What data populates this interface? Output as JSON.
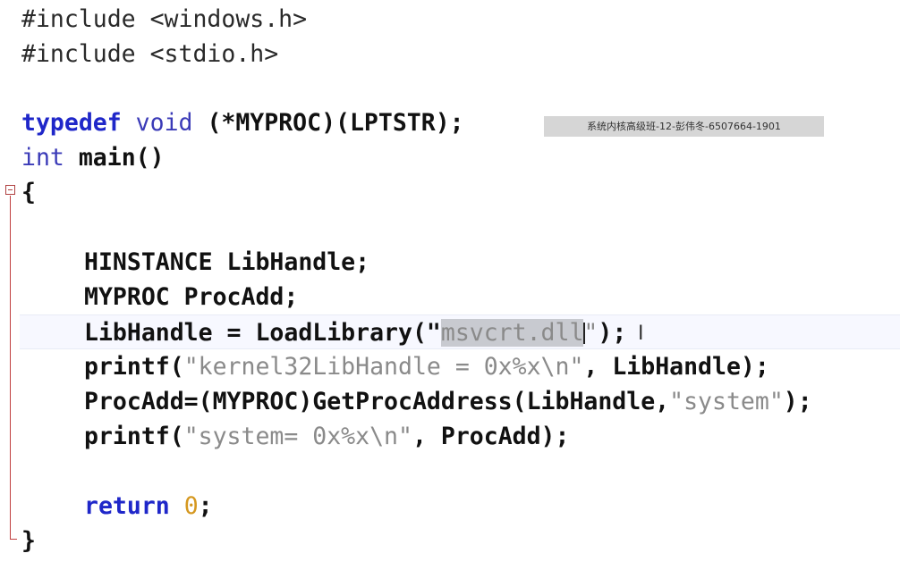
{
  "editor": {
    "lines": {
      "include1_kw": "#include",
      "include1_file": " <windows.h>",
      "include2_kw": "#include",
      "include2_file": " <stdio.h>",
      "typedef_kw": "typedef",
      "typedef_void": "void",
      "typedef_rest": " (*MYPROC)(LPTSTR);",
      "main_kw": "int",
      "main_rest": " main()",
      "open_brace": "{",
      "decl1": "HINSTANCE LibHandle;",
      "decl2": "MYPROC ProcAdd;",
      "load_pre": "LibHandle = LoadLibrary(\"",
      "load_sel": "msvcrt.dll",
      "load_post_str": "\"",
      "load_end": ");",
      "printf1_fn": "printf(",
      "printf1_str": "\"kernel32LibHandle = 0x%x\\n\"",
      "printf1_end": ", LibHandle);",
      "procadd_pre": "ProcAdd=(MYPROC)GetProcAddress(LibHandle,",
      "procadd_str": "\"system\"",
      "procadd_end": ");",
      "printf2_fn": "printf(",
      "printf2_str": "\"system= 0x%x\\n\"",
      "printf2_end": ", ProcAdd);",
      "return_kw": "return",
      "return_num": "0",
      "return_end": ";",
      "close_brace": "}"
    }
  },
  "watermark": {
    "text": "系统内核高级班-12-彭伟冬-6507664-1901"
  },
  "colors": {
    "keyword": "#1f27c9",
    "string": "#8a8a8a",
    "number": "#d59820",
    "selection": "#c8cad0",
    "current_line": "#f7f8ff",
    "fold_marker": "#c04040"
  }
}
